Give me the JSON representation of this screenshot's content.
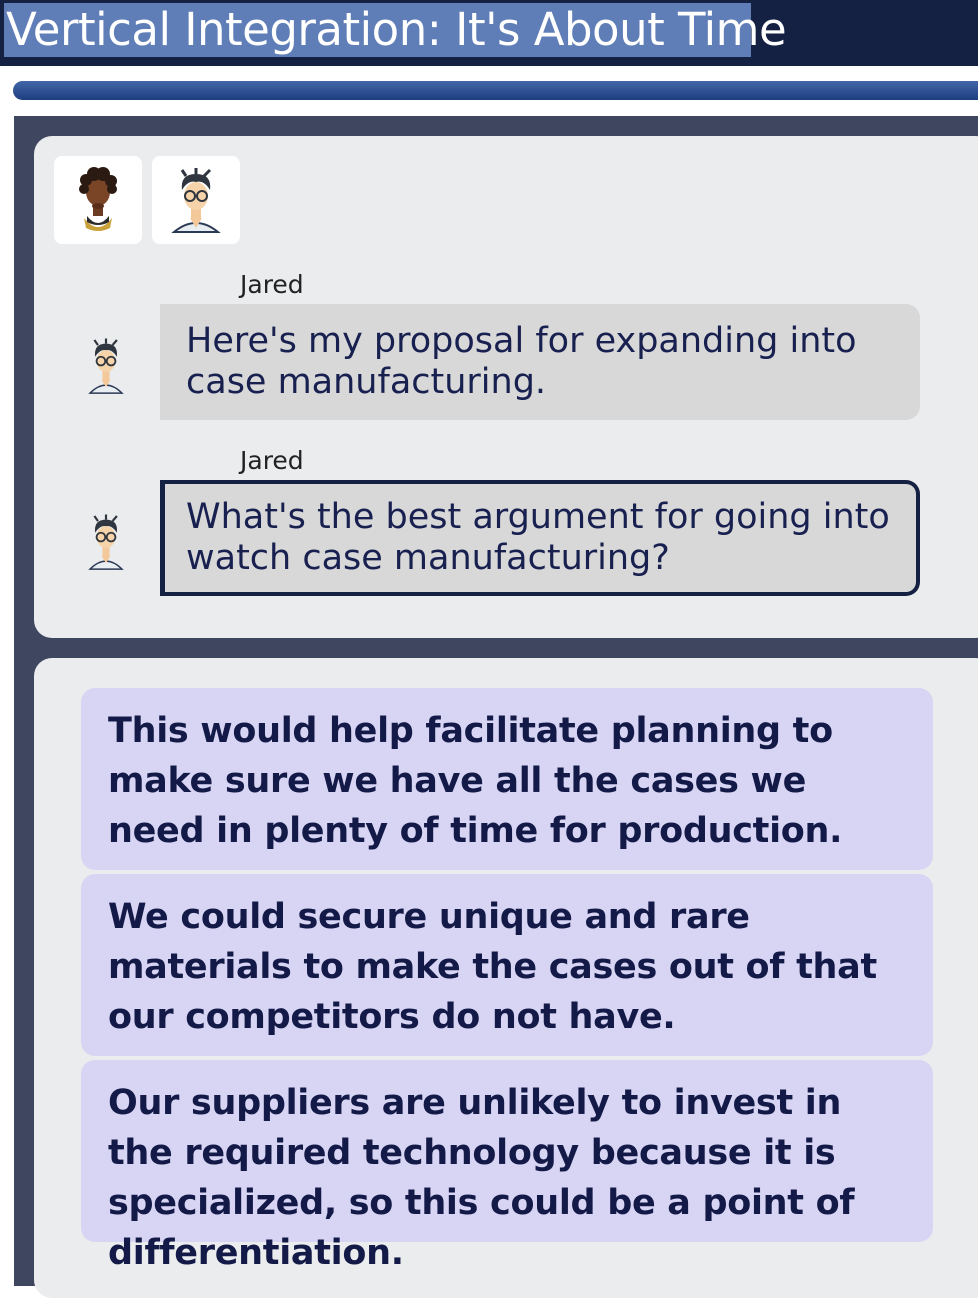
{
  "header": {
    "title": "Vertical Integration: It's About Time"
  },
  "progress": {
    "fraction": 1.0
  },
  "participants": [
    {
      "name": "participant-1",
      "icon": "avatar-woman-icon"
    },
    {
      "name": "Jared",
      "icon": "avatar-man-glasses-icon"
    }
  ],
  "messages": [
    {
      "speaker": "Jared",
      "text": "Here's my proposal for expanding into case manufacturing.",
      "icon": "avatar-man-glasses-icon"
    },
    {
      "speaker": "Jared",
      "text": "What's the best argument for going into watch case manufacturing?",
      "icon": "avatar-man-glasses-icon"
    }
  ],
  "choices": [
    {
      "text": "This would help facilitate planning to make sure we have all the cases we need in plenty of time for production."
    },
    {
      "text": "We could secure unique and rare materials to make the cases out of that our competitors do not have."
    },
    {
      "text": "Our suppliers are unlikely to invest in the required technology because it is specialized, so this could be a point of differentiation."
    }
  ],
  "colors": {
    "header_bg": "#152142",
    "title_highlight": "#5f7eb7",
    "panel_bg": "#3f4760",
    "card_bg": "#ebeced",
    "bubble_bg": "#d8d8d8",
    "choice_bg": "#d8d5f4",
    "text_dark": "#141a48"
  }
}
